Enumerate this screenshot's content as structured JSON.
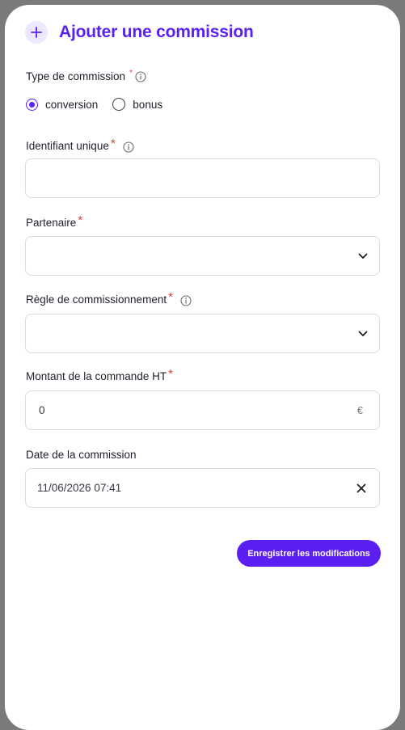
{
  "header": {
    "title": "Ajouter une commission",
    "icon": "plus-icon",
    "accent_color": "#5b21f0"
  },
  "commission_type": {
    "label": "Type de commission",
    "required_mark": "*",
    "options": [
      {
        "label": "conversion",
        "selected": true
      },
      {
        "label": "bonus",
        "selected": false
      }
    ]
  },
  "unique_id": {
    "label": "Identifiant unique",
    "required_mark": "*",
    "value": ""
  },
  "partner": {
    "label": "Partenaire",
    "required_mark": "*",
    "value": ""
  },
  "rule": {
    "label": "Règle de commissionnement",
    "required_mark": "*",
    "value": ""
  },
  "amount": {
    "label": "Montant de la commande HT",
    "required_mark": "*",
    "value": "0",
    "suffix": "€"
  },
  "date": {
    "label": "Date de la commission",
    "value": "11/06/2026 07:41"
  },
  "actions": {
    "save_label": "Enregistrer les modifications"
  }
}
